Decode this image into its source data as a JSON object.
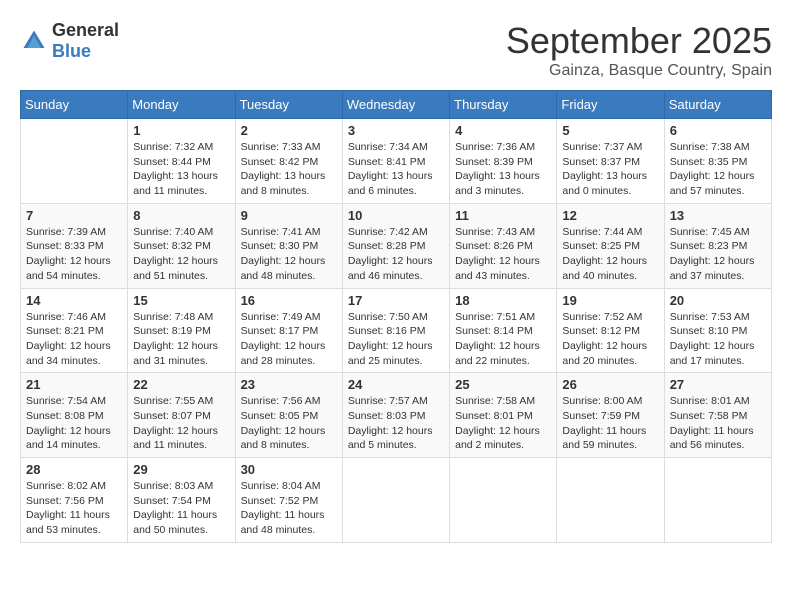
{
  "header": {
    "logo_general": "General",
    "logo_blue": "Blue",
    "month": "September 2025",
    "location": "Gainza, Basque Country, Spain"
  },
  "days_of_week": [
    "Sunday",
    "Monday",
    "Tuesday",
    "Wednesday",
    "Thursday",
    "Friday",
    "Saturday"
  ],
  "weeks": [
    [
      {
        "day": "",
        "sunrise": "",
        "sunset": "",
        "daylight": ""
      },
      {
        "day": "1",
        "sunrise": "Sunrise: 7:32 AM",
        "sunset": "Sunset: 8:44 PM",
        "daylight": "Daylight: 13 hours and 11 minutes."
      },
      {
        "day": "2",
        "sunrise": "Sunrise: 7:33 AM",
        "sunset": "Sunset: 8:42 PM",
        "daylight": "Daylight: 13 hours and 8 minutes."
      },
      {
        "day": "3",
        "sunrise": "Sunrise: 7:34 AM",
        "sunset": "Sunset: 8:41 PM",
        "daylight": "Daylight: 13 hours and 6 minutes."
      },
      {
        "day": "4",
        "sunrise": "Sunrise: 7:36 AM",
        "sunset": "Sunset: 8:39 PM",
        "daylight": "Daylight: 13 hours and 3 minutes."
      },
      {
        "day": "5",
        "sunrise": "Sunrise: 7:37 AM",
        "sunset": "Sunset: 8:37 PM",
        "daylight": "Daylight: 13 hours and 0 minutes."
      },
      {
        "day": "6",
        "sunrise": "Sunrise: 7:38 AM",
        "sunset": "Sunset: 8:35 PM",
        "daylight": "Daylight: 12 hours and 57 minutes."
      }
    ],
    [
      {
        "day": "7",
        "sunrise": "Sunrise: 7:39 AM",
        "sunset": "Sunset: 8:33 PM",
        "daylight": "Daylight: 12 hours and 54 minutes."
      },
      {
        "day": "8",
        "sunrise": "Sunrise: 7:40 AM",
        "sunset": "Sunset: 8:32 PM",
        "daylight": "Daylight: 12 hours and 51 minutes."
      },
      {
        "day": "9",
        "sunrise": "Sunrise: 7:41 AM",
        "sunset": "Sunset: 8:30 PM",
        "daylight": "Daylight: 12 hours and 48 minutes."
      },
      {
        "day": "10",
        "sunrise": "Sunrise: 7:42 AM",
        "sunset": "Sunset: 8:28 PM",
        "daylight": "Daylight: 12 hours and 46 minutes."
      },
      {
        "day": "11",
        "sunrise": "Sunrise: 7:43 AM",
        "sunset": "Sunset: 8:26 PM",
        "daylight": "Daylight: 12 hours and 43 minutes."
      },
      {
        "day": "12",
        "sunrise": "Sunrise: 7:44 AM",
        "sunset": "Sunset: 8:25 PM",
        "daylight": "Daylight: 12 hours and 40 minutes."
      },
      {
        "day": "13",
        "sunrise": "Sunrise: 7:45 AM",
        "sunset": "Sunset: 8:23 PM",
        "daylight": "Daylight: 12 hours and 37 minutes."
      }
    ],
    [
      {
        "day": "14",
        "sunrise": "Sunrise: 7:46 AM",
        "sunset": "Sunset: 8:21 PM",
        "daylight": "Daylight: 12 hours and 34 minutes."
      },
      {
        "day": "15",
        "sunrise": "Sunrise: 7:48 AM",
        "sunset": "Sunset: 8:19 PM",
        "daylight": "Daylight: 12 hours and 31 minutes."
      },
      {
        "day": "16",
        "sunrise": "Sunrise: 7:49 AM",
        "sunset": "Sunset: 8:17 PM",
        "daylight": "Daylight: 12 hours and 28 minutes."
      },
      {
        "day": "17",
        "sunrise": "Sunrise: 7:50 AM",
        "sunset": "Sunset: 8:16 PM",
        "daylight": "Daylight: 12 hours and 25 minutes."
      },
      {
        "day": "18",
        "sunrise": "Sunrise: 7:51 AM",
        "sunset": "Sunset: 8:14 PM",
        "daylight": "Daylight: 12 hours and 22 minutes."
      },
      {
        "day": "19",
        "sunrise": "Sunrise: 7:52 AM",
        "sunset": "Sunset: 8:12 PM",
        "daylight": "Daylight: 12 hours and 20 minutes."
      },
      {
        "day": "20",
        "sunrise": "Sunrise: 7:53 AM",
        "sunset": "Sunset: 8:10 PM",
        "daylight": "Daylight: 12 hours and 17 minutes."
      }
    ],
    [
      {
        "day": "21",
        "sunrise": "Sunrise: 7:54 AM",
        "sunset": "Sunset: 8:08 PM",
        "daylight": "Daylight: 12 hours and 14 minutes."
      },
      {
        "day": "22",
        "sunrise": "Sunrise: 7:55 AM",
        "sunset": "Sunset: 8:07 PM",
        "daylight": "Daylight: 12 hours and 11 minutes."
      },
      {
        "day": "23",
        "sunrise": "Sunrise: 7:56 AM",
        "sunset": "Sunset: 8:05 PM",
        "daylight": "Daylight: 12 hours and 8 minutes."
      },
      {
        "day": "24",
        "sunrise": "Sunrise: 7:57 AM",
        "sunset": "Sunset: 8:03 PM",
        "daylight": "Daylight: 12 hours and 5 minutes."
      },
      {
        "day": "25",
        "sunrise": "Sunrise: 7:58 AM",
        "sunset": "Sunset: 8:01 PM",
        "daylight": "Daylight: 12 hours and 2 minutes."
      },
      {
        "day": "26",
        "sunrise": "Sunrise: 8:00 AM",
        "sunset": "Sunset: 7:59 PM",
        "daylight": "Daylight: 11 hours and 59 minutes."
      },
      {
        "day": "27",
        "sunrise": "Sunrise: 8:01 AM",
        "sunset": "Sunset: 7:58 PM",
        "daylight": "Daylight: 11 hours and 56 minutes."
      }
    ],
    [
      {
        "day": "28",
        "sunrise": "Sunrise: 8:02 AM",
        "sunset": "Sunset: 7:56 PM",
        "daylight": "Daylight: 11 hours and 53 minutes."
      },
      {
        "day": "29",
        "sunrise": "Sunrise: 8:03 AM",
        "sunset": "Sunset: 7:54 PM",
        "daylight": "Daylight: 11 hours and 50 minutes."
      },
      {
        "day": "30",
        "sunrise": "Sunrise: 8:04 AM",
        "sunset": "Sunset: 7:52 PM",
        "daylight": "Daylight: 11 hours and 48 minutes."
      },
      {
        "day": "",
        "sunrise": "",
        "sunset": "",
        "daylight": ""
      },
      {
        "day": "",
        "sunrise": "",
        "sunset": "",
        "daylight": ""
      },
      {
        "day": "",
        "sunrise": "",
        "sunset": "",
        "daylight": ""
      },
      {
        "day": "",
        "sunrise": "",
        "sunset": "",
        "daylight": ""
      }
    ]
  ]
}
